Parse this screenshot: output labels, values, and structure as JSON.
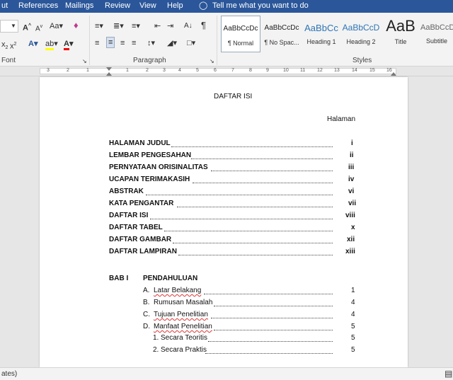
{
  "menu": {
    "items": [
      "ut",
      "References",
      "Mailings",
      "Review",
      "View",
      "Help"
    ],
    "tell_me": "Tell me what you want to do"
  },
  "ribbon": {
    "groups": {
      "font": "Font",
      "paragraph": "Paragraph",
      "styles": "Styles"
    },
    "styles": [
      {
        "preview": "AaBbCcDc",
        "name": "¶ Normal"
      },
      {
        "preview": "AaBbCcDc",
        "name": "¶ No Spac..."
      },
      {
        "preview": "AaBbCc",
        "name": "Heading 1"
      },
      {
        "preview": "AaBbCcD",
        "name": "Heading 2"
      },
      {
        "preview": "AaB",
        "name": "Title"
      },
      {
        "preview": "AaBbCcD",
        "name": "Subtitle"
      }
    ]
  },
  "ruler": {
    "numbers": [
      "3",
      "2",
      "1",
      "1",
      "2",
      "3",
      "4",
      "5",
      "6",
      "7",
      "8",
      "9",
      "10",
      "11",
      "12",
      "13",
      "14",
      "15",
      "16"
    ]
  },
  "document": {
    "title": "DAFTAR ISI",
    "halaman": "Halaman",
    "toc": [
      {
        "label": "HALAMAN JUDUL",
        "page": "i"
      },
      {
        "label": "LEMBAR PENGESAHAN",
        "page": "ii"
      },
      {
        "label": "PERNYATAAN ORISINALITAS",
        "page": "iii"
      },
      {
        "label": "UCAPAN TERIMAKASIH",
        "page": "iv"
      },
      {
        "label": "ABSTRAK",
        "page": "vi"
      },
      {
        "label": "KATA PENGANTAR",
        "page": "vii"
      },
      {
        "label": "DAFTAR ISI",
        "page": "viii"
      },
      {
        "label": "DAFTAR TABEL",
        "page": "x"
      },
      {
        "label": "DAFTAR GAMBAR",
        "page": "xii"
      },
      {
        "label": "DAFTAR LAMPIRAN",
        "page": "xiii"
      }
    ],
    "bab": {
      "num": "BAB I",
      "title": "PENDAHULUAN"
    },
    "sub": [
      {
        "letter": "A.",
        "label": "Latar Belakang",
        "page": "1"
      },
      {
        "letter": "B.",
        "label": "Rumusan Masalah",
        "page": "4"
      },
      {
        "letter": "C.",
        "label": "Tujuan Penelitian",
        "page": "4"
      },
      {
        "letter": "D.",
        "label": "Manfaat Penelitian",
        "page": "5"
      }
    ],
    "subsub": [
      {
        "num": "1.",
        "label": "Secara Teoritis",
        "page": "5"
      },
      {
        "num": "2.",
        "label": "Secara Praktis",
        "page": "5"
      }
    ]
  },
  "status": {
    "left": "ates)"
  }
}
